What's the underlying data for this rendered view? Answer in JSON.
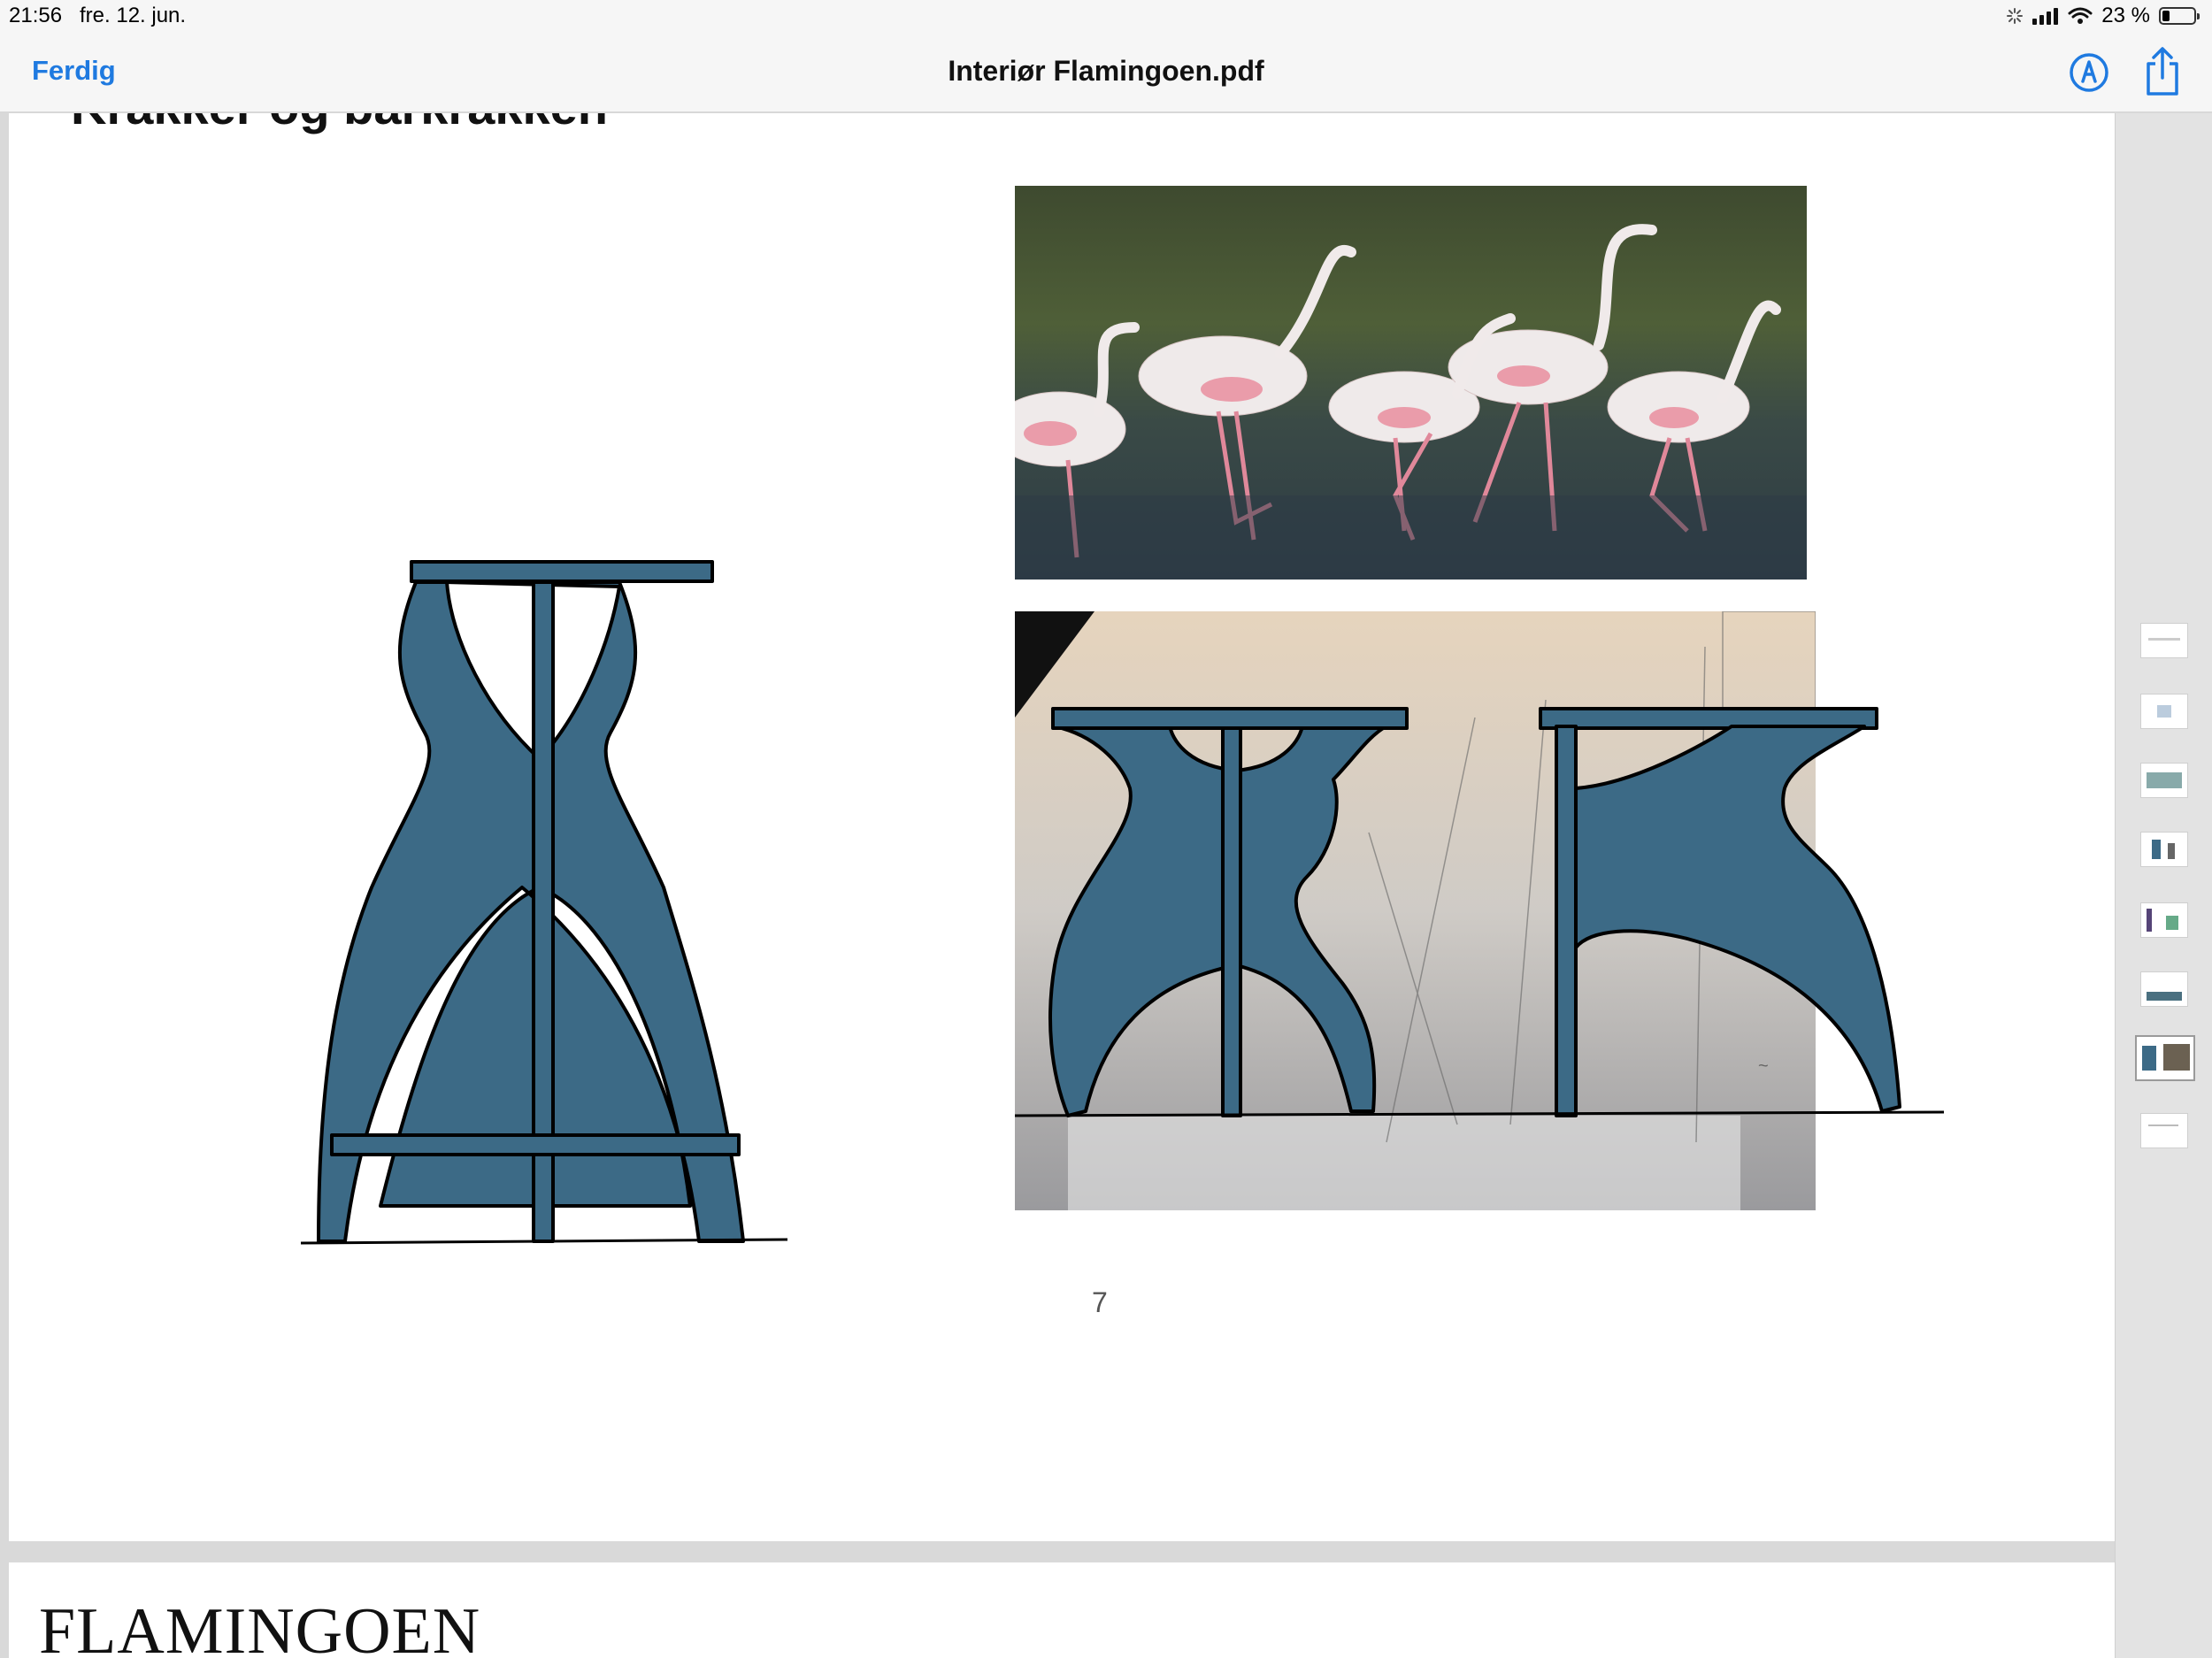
{
  "status_bar": {
    "time": "21:56",
    "date": "fre. 12. jun.",
    "battery_text": "23 %",
    "battery_level": 0.23,
    "icons": [
      "loading-spinner-icon",
      "cellular-signal-icon",
      "wifi-icon",
      "battery-icon"
    ]
  },
  "nav": {
    "done_label": "Ferdig",
    "title": "Interiør Flamingoen.pdf",
    "markup_icon": "markup-pen-icon",
    "share_icon": "share-icon",
    "accent_color": "#1f7ae0"
  },
  "page": {
    "heading_partial": "Krakker og barkrakken",
    "page_number": "7",
    "stool_color": "#3c6a86",
    "images": [
      "flamingo-photo",
      "sketch-photo-with-stool-overlays"
    ]
  },
  "next_page": {
    "brand": "FLAMINGOEN"
  },
  "thumbnails": {
    "count": 8,
    "active_index": 6
  }
}
